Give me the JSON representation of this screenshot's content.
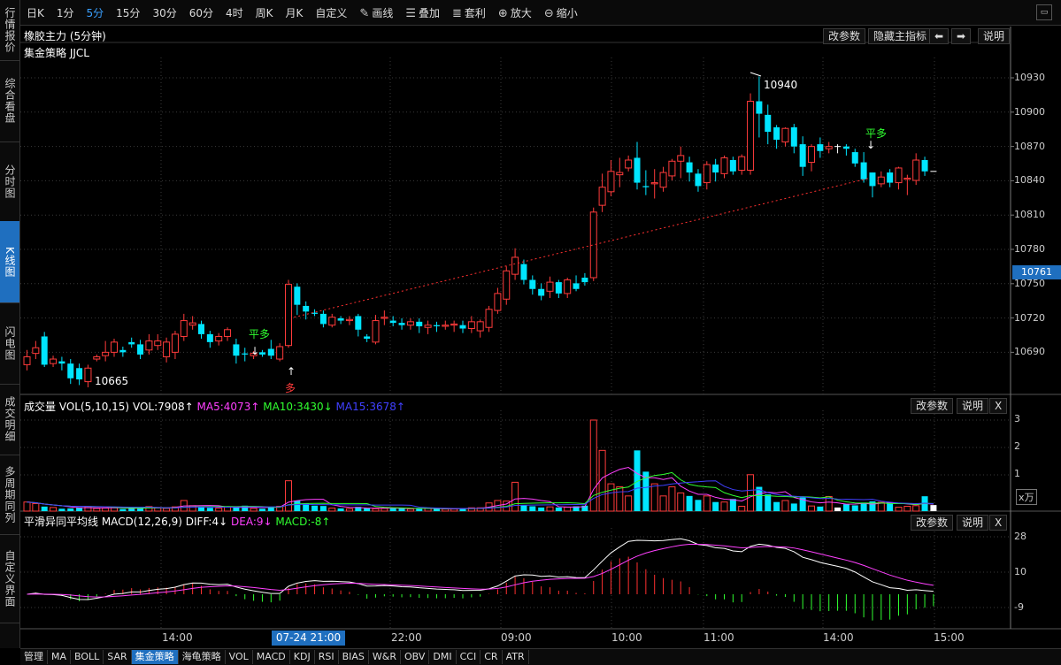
{
  "sidebar": [
    {
      "label": "行情报价",
      "active": false
    },
    {
      "label": "综合看盘",
      "active": false
    },
    {
      "label": "分时图",
      "active": false
    },
    {
      "label": "K线图",
      "active": true
    },
    {
      "label": "闪电图",
      "active": false
    },
    {
      "label": "成交明细",
      "active": false
    },
    {
      "label": "多周期同列",
      "active": false
    },
    {
      "label": "自定义界面",
      "active": false
    }
  ],
  "toolbar": {
    "periods": [
      {
        "label": "日K",
        "active": false
      },
      {
        "label": "1分",
        "active": false
      },
      {
        "label": "5分",
        "active": true
      },
      {
        "label": "15分",
        "active": false
      },
      {
        "label": "30分",
        "active": false
      },
      {
        "label": "60分",
        "active": false
      },
      {
        "label": "4时",
        "active": false
      },
      {
        "label": "周K",
        "active": false
      },
      {
        "label": "月K",
        "active": false
      },
      {
        "label": "自定义",
        "active": false
      }
    ],
    "draw": "画线",
    "overlay": "叠加",
    "arbitrage": "套利",
    "zoom_in": "放大",
    "zoom_out": "缩小"
  },
  "main_panel": {
    "title": "橡胶主力 (5分钟)",
    "strategy": "集金策略 JJCL",
    "buttons": {
      "params": "改参数",
      "hide": "隐藏主指标",
      "prev": "⬅",
      "next": "➡",
      "help": "说明"
    },
    "y_ticks": [
      "10930",
      "10900",
      "10870",
      "10840",
      "10810",
      "10780",
      "10750",
      "10720",
      "10690"
    ],
    "current_price": "10761",
    "high_label": "10940",
    "low_label": "10665",
    "signals": {
      "flat_long_1": "平多",
      "long": "多",
      "flat_long_2": "平多"
    }
  },
  "vol_panel": {
    "title": "成交量 VOL(5,10,15)",
    "vol": "VOL:7908↑",
    "ma5": "MA5:4073↑",
    "ma10": "MA10:3430↓",
    "ma15": "MA15:3678↑",
    "buttons": {
      "params": "改参数",
      "help": "说明",
      "close": "X"
    },
    "y_ticks": [
      "3",
      "2",
      "1"
    ],
    "unit": "x万"
  },
  "macd_panel": {
    "title": "平滑异同平均线 MACD(12,26,9)",
    "diff": "DIFF:4↓",
    "dea": "DEA:9↓",
    "macd": "MACD:-8↑",
    "buttons": {
      "params": "改参数",
      "help": "说明",
      "close": "X"
    },
    "y_ticks": [
      "28",
      "10",
      "-9"
    ]
  },
  "x_axis": {
    "labels": [
      "14:00",
      "22:00",
      "09:00",
      "10:00",
      "11:00",
      "14:00",
      "15:00"
    ],
    "crosshair": "07-24 21:00"
  },
  "bottom_tabs": [
    {
      "label": "管理",
      "active": false
    },
    {
      "label": "MA",
      "active": false
    },
    {
      "label": "BOLL",
      "active": false
    },
    {
      "label": "SAR",
      "active": false
    },
    {
      "label": "集金策略",
      "active": true
    },
    {
      "label": "海龟策略",
      "active": false
    },
    {
      "label": "VOL",
      "active": false
    },
    {
      "label": "MACD",
      "active": false
    },
    {
      "label": "KDJ",
      "active": false
    },
    {
      "label": "RSI",
      "active": false
    },
    {
      "label": "BIAS",
      "active": false
    },
    {
      "label": "W&R",
      "active": false
    },
    {
      "label": "OBV",
      "active": false
    },
    {
      "label": "DMI",
      "active": false
    },
    {
      "label": "CCI",
      "active": false
    },
    {
      "label": "CR",
      "active": false
    },
    {
      "label": "ATR",
      "active": false
    }
  ],
  "colors": {
    "up": "#ff3b3b",
    "down": "#00e5ff",
    "ma5": "#ff40ff",
    "ma10": "#30ff30",
    "ma15": "#4040ff",
    "accent": "#1f6fbf"
  },
  "chart_data": {
    "type": "candlestick",
    "y_range": [
      10665,
      10945
    ],
    "candles": [
      [
        10685,
        10692,
        10680,
        10698
      ],
      [
        10695,
        10700,
        10690,
        10706
      ],
      [
        10710,
        10685,
        10683,
        10714
      ],
      [
        10686,
        10690,
        10683,
        10693
      ],
      [
        10688,
        10686,
        10680,
        10692
      ],
      [
        10686,
        10673,
        10668,
        10690
      ],
      [
        10682,
        10672,
        10667,
        10686
      ],
      [
        10670,
        10682,
        10665,
        10685
      ],
      [
        10690,
        10692,
        10688,
        10694
      ],
      [
        10693,
        10696,
        10688,
        10706
      ],
      [
        10696,
        10705,
        10692,
        10708
      ],
      [
        10698,
        10696,
        10692,
        10701
      ],
      [
        10705,
        10703,
        10700,
        10709
      ],
      [
        10703,
        10694,
        10690,
        10707
      ],
      [
        10698,
        10706,
        10694,
        10712
      ],
      [
        10702,
        10706,
        10698,
        10712
      ],
      [
        10692,
        10705,
        10687,
        10709
      ],
      [
        10696,
        10712,
        10690,
        10715
      ],
      [
        10710,
        10724,
        10706,
        10730
      ],
      [
        10720,
        10722,
        10716,
        10728
      ],
      [
        10721,
        10712,
        10708,
        10724
      ],
      [
        10712,
        10705,
        10700,
        10715
      ],
      [
        10706,
        10710,
        10702,
        10713
      ],
      [
        10710,
        10716,
        10706,
        10718
      ],
      [
        10703,
        10693,
        10686,
        10708
      ],
      [
        10695,
        10694,
        10688,
        10700
      ],
      [
        10693,
        10695,
        10690,
        10697
      ],
      [
        10696,
        10694,
        10692,
        10698
      ],
      [
        10699,
        10693,
        10690,
        10707
      ],
      [
        10690,
        10701,
        10688,
        10704
      ],
      [
        10702,
        10756,
        10700,
        10760
      ],
      [
        10754,
        10738,
        10729,
        10757
      ],
      [
        10737,
        10732,
        10725,
        10741
      ],
      [
        10731,
        10730,
        10728,
        10734
      ],
      [
        10730,
        10721,
        10718,
        10733
      ],
      [
        10720,
        10727,
        10718,
        10730
      ],
      [
        10726,
        10724,
        10721,
        10728
      ],
      [
        10724,
        10725,
        10720,
        10728
      ],
      [
        10728,
        10716,
        10710,
        10730
      ],
      [
        10710,
        10708,
        10705,
        10712
      ],
      [
        10705,
        10724,
        10703,
        10729
      ],
      [
        10726,
        10727,
        10720,
        10733
      ],
      [
        10724,
        10722,
        10719,
        10728
      ],
      [
        10722,
        10720,
        10716,
        10726
      ],
      [
        10720,
        10723,
        10716,
        10726
      ],
      [
        10723,
        10719,
        10713,
        10726
      ],
      [
        10718,
        10720,
        10712,
        10724
      ],
      [
        10720,
        10719,
        10714,
        10723
      ],
      [
        10719,
        10720,
        10716,
        10724
      ],
      [
        10720,
        10721,
        10714,
        10724
      ],
      [
        10720,
        10717,
        10713,
        10724
      ],
      [
        10717,
        10723,
        10713,
        10728
      ],
      [
        10715,
        10723,
        10709,
        10725
      ],
      [
        10718,
        10734,
        10714,
        10737
      ],
      [
        10733,
        10748,
        10730,
        10753
      ],
      [
        10743,
        10768,
        10738,
        10772
      ],
      [
        10765,
        10780,
        10760,
        10788
      ],
      [
        10774,
        10760,
        10756,
        10778
      ],
      [
        10760,
        10752,
        10747,
        10764
      ],
      [
        10752,
        10746,
        10742,
        10757
      ],
      [
        10750,
        10758,
        10744,
        10763
      ],
      [
        10758,
        10748,
        10744,
        10760
      ],
      [
        10748,
        10760,
        10744,
        10762
      ],
      [
        10757,
        10752,
        10750,
        10764
      ],
      [
        10762,
        10758,
        10755,
        10766
      ],
      [
        10762,
        10820,
        10759,
        10824
      ],
      [
        10826,
        10842,
        10820,
        10854
      ],
      [
        10838,
        10856,
        10834,
        10866
      ],
      [
        10853,
        10855,
        10842,
        10868
      ],
      [
        10859,
        10866,
        10856,
        10870
      ],
      [
        10868,
        10846,
        10840,
        10882
      ],
      [
        10843,
        10842,
        10835,
        10857
      ],
      [
        10845,
        10846,
        10832,
        10858
      ],
      [
        10842,
        10855,
        10838,
        10860
      ],
      [
        10852,
        10865,
        10848,
        10867
      ],
      [
        10865,
        10870,
        10850,
        10878
      ],
      [
        10864,
        10855,
        10847,
        10869
      ],
      [
        10854,
        10843,
        10838,
        10858
      ],
      [
        10846,
        10862,
        10840,
        10865
      ],
      [
        10862,
        10855,
        10847,
        10867
      ],
      [
        10854,
        10868,
        10850,
        10870
      ],
      [
        10866,
        10856,
        10853,
        10869
      ],
      [
        10857,
        10869,
        10853,
        10871
      ],
      [
        10857,
        10918,
        10853,
        10925
      ],
      [
        10918,
        10907,
        10886,
        10940
      ],
      [
        10906,
        10891,
        10880,
        10915
      ],
      [
        10895,
        10884,
        10876,
        10897
      ],
      [
        10882,
        10894,
        10878,
        10895
      ],
      [
        10895,
        10878,
        10872,
        10898
      ],
      [
        10880,
        10860,
        10852,
        10887
      ],
      [
        10864,
        10878,
        10856,
        10880
      ],
      [
        10880,
        10874,
        10868,
        10886
      ],
      [
        10876,
        10878,
        10872,
        10882
      ],
      [
        10878,
        10878,
        10872,
        10880
      ],
      [
        10878,
        10876,
        10870,
        10880
      ],
      [
        10873,
        10863,
        10860,
        10876
      ],
      [
        10864,
        10849,
        10846,
        10873
      ],
      [
        10855,
        10843,
        10833,
        10855
      ],
      [
        10845,
        10851,
        10842,
        10856
      ],
      [
        10855,
        10846,
        10842,
        10858
      ],
      [
        10846,
        10859,
        10840,
        10860
      ],
      [
        10849,
        10850,
        10835,
        10853
      ],
      [
        10848,
        10866,
        10844,
        10872
      ],
      [
        10866,
        10856,
        10852,
        10869
      ],
      [
        10856,
        10856,
        10856,
        10856
      ]
    ],
    "volume": [
      3000,
      2500,
      1500,
      1200,
      800,
      900,
      1200,
      1500,
      900,
      1000,
      1100,
      700,
      900,
      1000,
      1500,
      1200,
      900,
      1400,
      3500,
      1800,
      1500,
      1100,
      1000,
      1300,
      1200,
      1800,
      900,
      800,
      1400,
      1600,
      10000,
      3500,
      2500,
      1800,
      1700,
      1000,
      900,
      800,
      1400,
      1000,
      800,
      900,
      1000,
      900,
      700,
      800,
      900,
      800,
      700,
      700,
      900,
      1100,
      1100,
      2700,
      3500,
      3300,
      9500,
      1900,
      1600,
      1200,
      1400,
      1200,
      1300,
      1600,
      1800,
      30000,
      20000,
      9000,
      8000,
      5000,
      20000,
      13000,
      9000,
      5000,
      8000,
      6000,
      5000,
      3700,
      5000,
      3000,
      3000,
      4000,
      1600,
      12000,
      8000,
      5500,
      3000,
      3500,
      2500,
      4500,
      1700,
      1500,
      4800,
      1200,
      2300,
      1900,
      2800,
      3200,
      2900,
      2900,
      1300,
      1600,
      1800,
      4900,
      2000
    ],
    "macd": {
      "diff_start": 11,
      "diff_end": 4,
      "dea_start": 10,
      "dea_end": 9,
      "macd_end": -8
    }
  }
}
